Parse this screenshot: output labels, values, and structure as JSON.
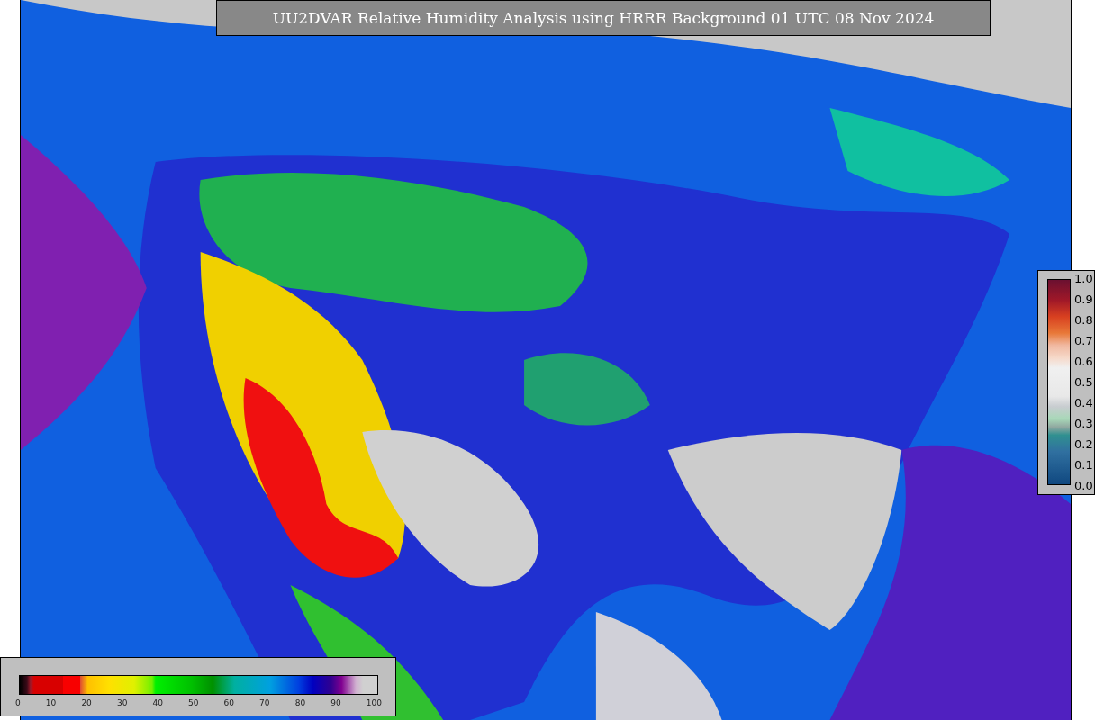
{
  "title": "UU2DVAR Relative Humidity Analysis using HRRR Background 01 UTC 08 Nov 2024",
  "ratio_colorbar": {
    "ticks": [
      "1.0",
      "0.9",
      "0.8",
      "0.7",
      "0.6",
      "0.5",
      "0.4",
      "0.3",
      "0.2",
      "0.1",
      "0.0"
    ]
  },
  "humidity_colorbar": {
    "ticks": [
      "0",
      "10",
      "20",
      "30",
      "40",
      "50",
      "60",
      "70",
      "80",
      "90",
      "100"
    ]
  }
}
